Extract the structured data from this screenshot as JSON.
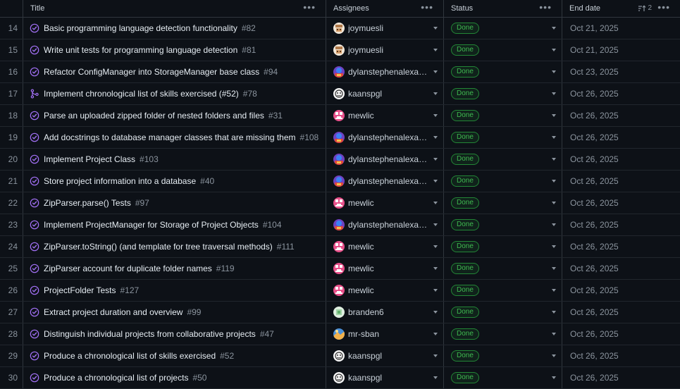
{
  "header": {
    "title": "Title",
    "assignees": "Assignees",
    "status": "Status",
    "end_date": "End date",
    "sort_count": "2"
  },
  "colors": {
    "done_border": "#238636",
    "done_text": "#3fb950",
    "issue_icon": "#a371f7"
  },
  "rows": [
    {
      "num": "14",
      "title": "Basic programming language detection functionality",
      "issue": "#82",
      "icon": "closed-issue-icon",
      "assignee": "joymuesli",
      "avatar": "joy",
      "status": "Done",
      "end": "Oct 21, 2025"
    },
    {
      "num": "15",
      "title": "Write unit tests for programming language detection",
      "issue": "#81",
      "icon": "closed-issue-icon",
      "assignee": "joymuesli",
      "avatar": "joy",
      "status": "Done",
      "end": "Oct 21, 2025"
    },
    {
      "num": "16",
      "title": "Refactor ConfigManager into StorageManager base class",
      "issue": "#94",
      "icon": "closed-issue-icon",
      "assignee": "dylanstephenalexan…",
      "avatar": "dylan",
      "status": "Done",
      "end": "Oct 23, 2025"
    },
    {
      "num": "17",
      "title": "Implement chronological list of skills exercised (#52)",
      "issue": "#78",
      "icon": "merged-pr-icon",
      "assignee": "kaanspgl",
      "avatar": "kaan",
      "status": "Done",
      "end": "Oct 26, 2025"
    },
    {
      "num": "18",
      "title": "Parse an uploaded zipped folder of nested folders and files",
      "issue": "#31",
      "icon": "closed-issue-icon",
      "assignee": "mewlic",
      "avatar": "mew",
      "status": "Done",
      "end": "Oct 26, 2025"
    },
    {
      "num": "19",
      "title": "Add docstrings to database manager classes that are missing them",
      "issue": "#108",
      "icon": "closed-issue-icon",
      "assignee": "dylanstephenalexan…",
      "avatar": "dylan",
      "status": "Done",
      "end": "Oct 26, 2025"
    },
    {
      "num": "20",
      "title": "Implement Project Class",
      "issue": "#103",
      "icon": "closed-issue-icon",
      "assignee": "dylanstephenalexan…",
      "avatar": "dylan",
      "status": "Done",
      "end": "Oct 26, 2025"
    },
    {
      "num": "21",
      "title": "Store project information into a database",
      "issue": "#40",
      "icon": "closed-issue-icon",
      "assignee": "dylanstephenalexan…",
      "avatar": "dylan",
      "status": "Done",
      "end": "Oct 26, 2025"
    },
    {
      "num": "22",
      "title": "ZipParser.parse() Tests",
      "issue": "#97",
      "icon": "closed-issue-icon",
      "assignee": "mewlic",
      "avatar": "mew",
      "status": "Done",
      "end": "Oct 26, 2025"
    },
    {
      "num": "23",
      "title": "Implement ProjectManager for Storage of Project Objects",
      "issue": "#104",
      "icon": "closed-issue-icon",
      "assignee": "dylanstephenalexan…",
      "avatar": "dylan",
      "status": "Done",
      "end": "Oct 26, 2025"
    },
    {
      "num": "24",
      "title": "ZipParser.toString() (and template for tree traversal methods)",
      "issue": "#111",
      "icon": "closed-issue-icon",
      "assignee": "mewlic",
      "avatar": "mew",
      "status": "Done",
      "end": "Oct 26, 2025"
    },
    {
      "num": "25",
      "title": "ZipParser account for duplicate folder names",
      "issue": "#119",
      "icon": "closed-issue-icon",
      "assignee": "mewlic",
      "avatar": "mew",
      "status": "Done",
      "end": "Oct 26, 2025"
    },
    {
      "num": "26",
      "title": "ProjectFolder Tests",
      "issue": "#127",
      "icon": "closed-issue-icon",
      "assignee": "mewlic",
      "avatar": "mew",
      "status": "Done",
      "end": "Oct 26, 2025"
    },
    {
      "num": "27",
      "title": "Extract project duration and overview",
      "issue": "#99",
      "icon": "closed-issue-icon",
      "assignee": "branden6",
      "avatar": "branden",
      "status": "Done",
      "end": "Oct 26, 2025"
    },
    {
      "num": "28",
      "title": "Distinguish individual projects from collaborative projects",
      "issue": "#47",
      "icon": "closed-issue-icon",
      "assignee": "mr-sban",
      "avatar": "sban",
      "status": "Done",
      "end": "Oct 26, 2025"
    },
    {
      "num": "29",
      "title": "Produce a chronological list of skills exercised",
      "issue": "#52",
      "icon": "closed-issue-icon",
      "assignee": "kaanspgl",
      "avatar": "kaan",
      "status": "Done",
      "end": "Oct 26, 2025"
    },
    {
      "num": "30",
      "title": "Produce a chronological list of projects",
      "issue": "#50",
      "icon": "closed-issue-icon",
      "assignee": "kaanspgl",
      "avatar": "kaan",
      "status": "Done",
      "end": "Oct 26, 2025"
    }
  ]
}
